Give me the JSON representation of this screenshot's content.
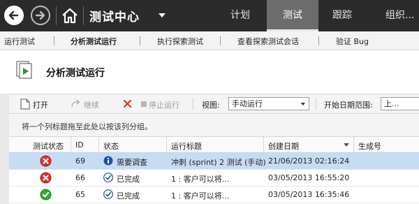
{
  "app": {
    "title": "测试中心",
    "tabs": [
      {
        "label": "计划"
      },
      {
        "label": "测试"
      },
      {
        "label": "跟踪"
      },
      {
        "label": "组织..."
      }
    ]
  },
  "subnav": [
    {
      "label": "运行测试"
    },
    {
      "label": "分析测试运行"
    },
    {
      "label": "执行探索测试"
    },
    {
      "label": "查看探索测试会话"
    },
    {
      "label": "验证 Bug"
    }
  ],
  "page": {
    "title": "分析测试运行"
  },
  "toolbar": {
    "open": "打开",
    "resume": "继续",
    "stop": "停止运行",
    "view_label": "视图:",
    "view_value": "手动运行",
    "date_label": "开始日期范围:",
    "date_value": "上..."
  },
  "group_hint": "将一个列标题拖至此处以按该列分组。",
  "grid": {
    "columns": [
      "测试状态",
      "ID",
      "状态",
      "运行标题",
      "创建日期",
      "生成号"
    ],
    "rows": [
      {
        "test_status": "failed",
        "id": "69",
        "state_icon": "info",
        "state": "需要调查",
        "title": "冲刺 (sprint) 2 测试 (手动)",
        "created": "21/06/2013 02:16:24",
        "build": ""
      },
      {
        "test_status": "failed",
        "id": "66",
        "state_icon": "check",
        "state": "已完成",
        "title": "1 : 客户可以将...",
        "created": "03/05/2013 16:55:20",
        "build": ""
      },
      {
        "test_status": "passed",
        "id": "65",
        "state_icon": "check",
        "state": "已完成",
        "title": "1 : 客户可以将...",
        "created": "03/05/2013 16:35:46",
        "build": ""
      }
    ]
  },
  "colors": {
    "topbar": "#2b2b2b",
    "active_tab": "#6c6c6c",
    "selected_row": "#c6dcf5",
    "fail": "#d9342b",
    "pass": "#3aa635",
    "info": "#1f4fa8"
  }
}
